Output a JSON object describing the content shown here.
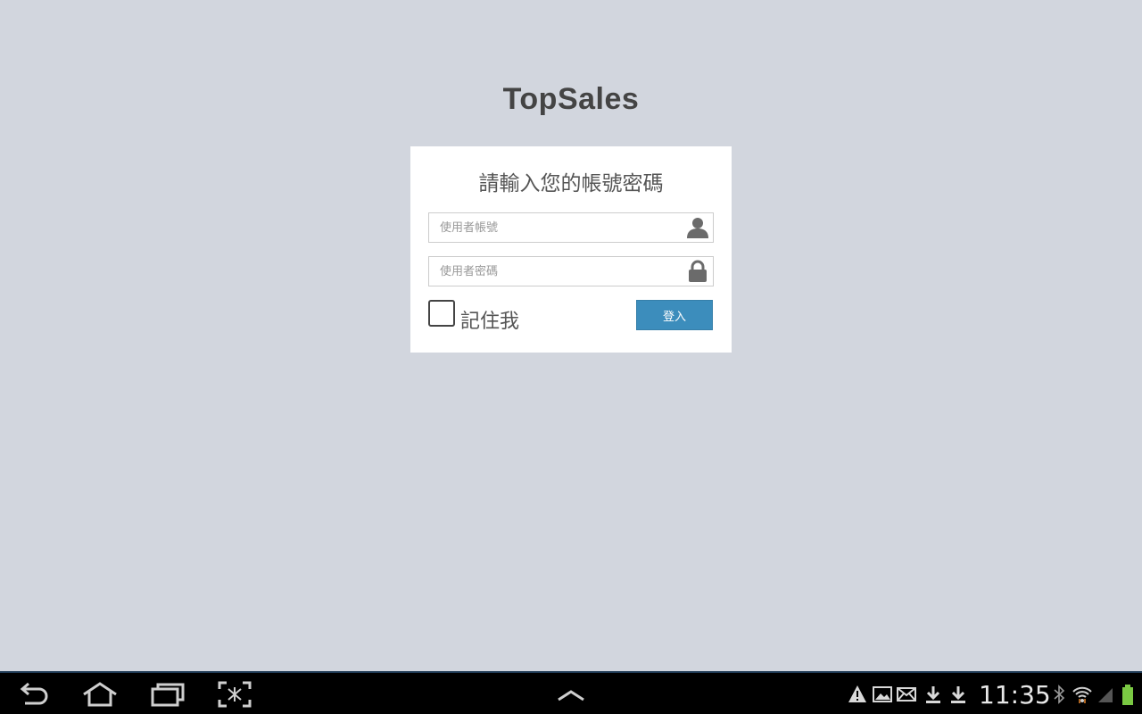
{
  "app": {
    "title": "TopSales"
  },
  "login": {
    "message": "請輸入您的帳號密碼",
    "username_placeholder": "使用者帳號",
    "username_value": "",
    "password_placeholder": "使用者密碼",
    "password_value": "",
    "remember_label": "記住我",
    "remember_checked": false,
    "submit_label": "登入",
    "icons": {
      "username": "user-icon",
      "password": "lock-icon"
    }
  },
  "system_bar": {
    "nav_buttons": [
      "back-icon",
      "home-icon",
      "recent-apps-icon",
      "screenshot-icon"
    ],
    "center_button": "chevron-up-icon",
    "status_icons": [
      "warning-icon",
      "image-icon",
      "email-icon",
      "download-icon",
      "download-icon",
      "bluetooth-icon",
      "wifi-icon",
      "signal-icon",
      "battery-icon"
    ],
    "clock": "11:35"
  },
  "colors": {
    "background": "#d2d6de",
    "primary_button": "#3c8dbc",
    "title_text": "#444444"
  }
}
